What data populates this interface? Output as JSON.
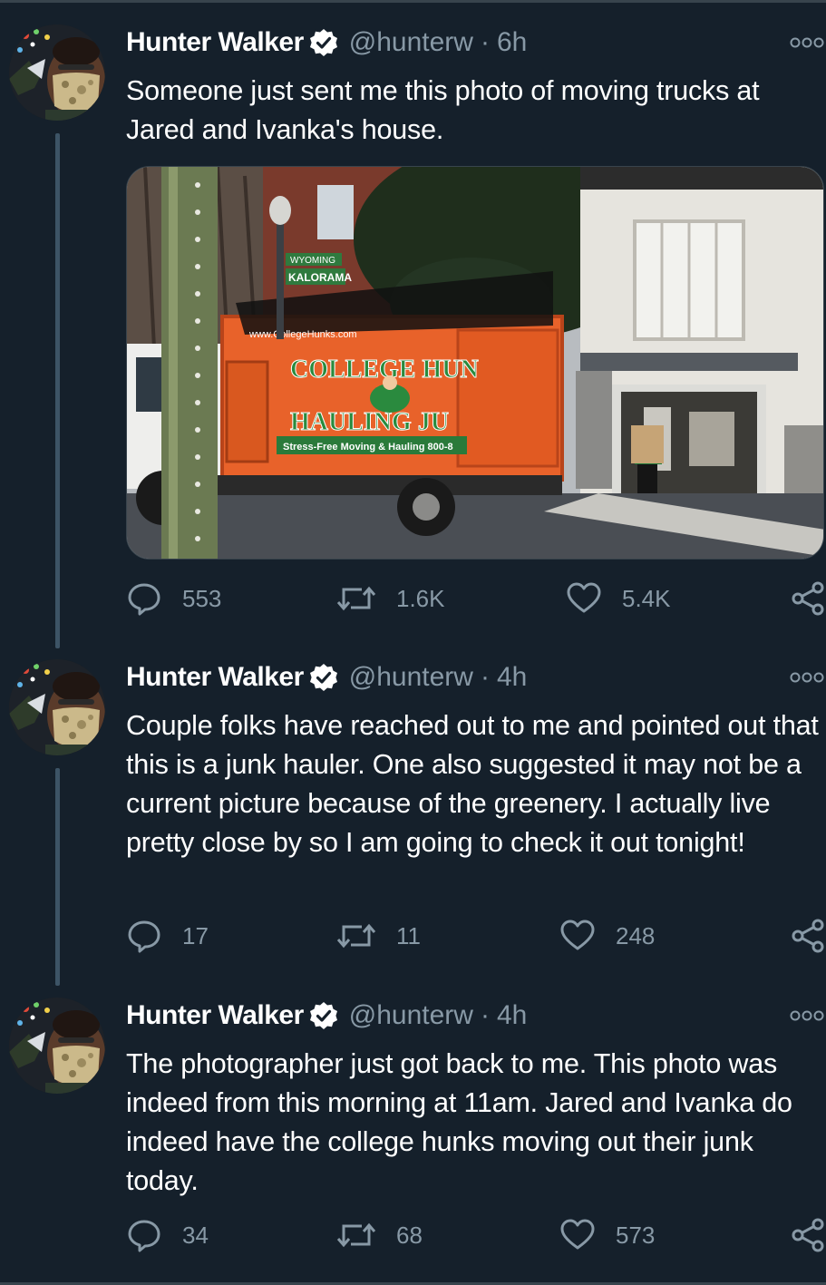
{
  "colors": {
    "background": "#15202b",
    "text_primary": "#ffffff",
    "text_secondary": "#8899a6",
    "verified_badge": "#ffffff",
    "thread_line": "#3d5466"
  },
  "icons": {
    "verified": "verified-badge-icon",
    "more": "more-options-icon",
    "reply": "reply-icon",
    "retweet": "retweet-icon",
    "like": "heart-icon",
    "share": "share-icon"
  },
  "tweets": [
    {
      "author_name": "Hunter Walker",
      "handle": "@hunterw",
      "separator": "·",
      "time": "6h",
      "text": "Someone just sent me this photo of moving trucks at Jared and Ivanka's house.",
      "has_media": true,
      "media_text": {
        "street_sign_1": "WYOMING",
        "street_sign_2": "KALORAMA",
        "truck_url": "www.CollegeHunks.com",
        "truck_line_1": "COLLEGE HUN",
        "truck_line_2": "HAULING JU",
        "truck_tagline": "Stress-Free Moving & Hauling 800-8"
      },
      "replies": "553",
      "retweets": "1.6K",
      "likes": "5.4K"
    },
    {
      "author_name": "Hunter Walker",
      "handle": "@hunterw",
      "separator": "·",
      "time": "4h",
      "text": "Couple folks have reached out to me and pointed out that this is a junk hauler. One also suggested it may not be a current picture because of the greenery. I actually live pretty close by so I am going to check it out tonight!",
      "has_media": false,
      "replies": "17",
      "retweets": "11",
      "likes": "248"
    },
    {
      "author_name": "Hunter Walker",
      "handle": "@hunterw",
      "separator": "·",
      "time": "4h",
      "text": "The photographer just got back to me. This photo was indeed from this morning at 11am. Jared and Ivanka do indeed have the college hunks moving out their junk today.",
      "has_media": false,
      "replies": "34",
      "retweets": "68",
      "likes": "573"
    }
  ]
}
